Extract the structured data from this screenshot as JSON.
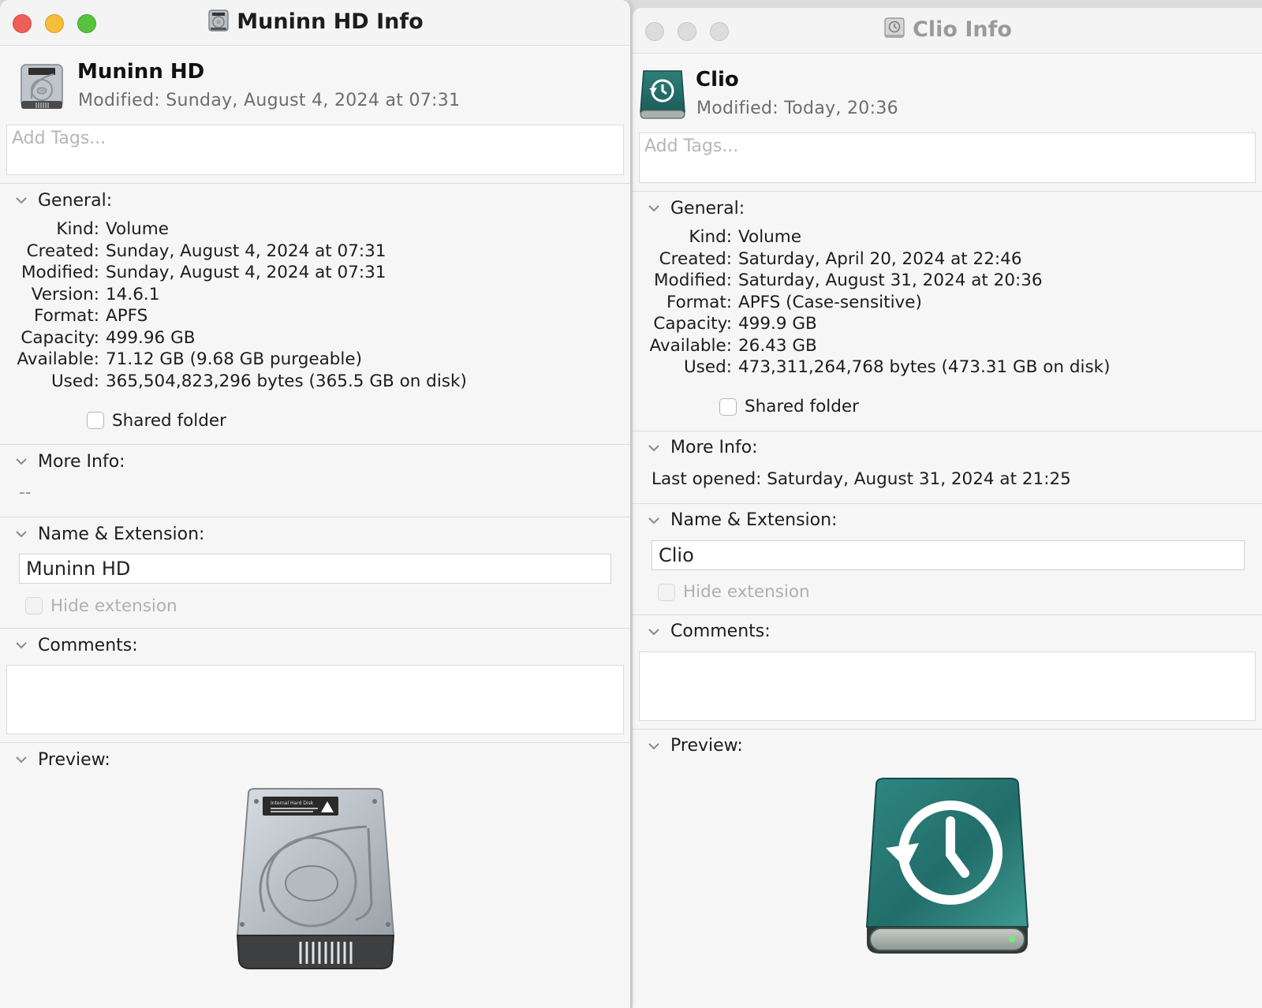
{
  "left": {
    "window_title": "Muninn HD Info",
    "volume_name": "Muninn HD",
    "modified_label": "Modified:",
    "modified_value": "Sunday, August 4, 2024 at 07:31",
    "tags_placeholder": "Add Tags...",
    "general": {
      "label": "General:",
      "rows": [
        {
          "k": "Kind:",
          "v": "Volume"
        },
        {
          "k": "Created:",
          "v": "Sunday, August 4, 2024 at 07:31"
        },
        {
          "k": "Modified:",
          "v": "Sunday, August 4, 2024 at 07:31"
        },
        {
          "k": "Version:",
          "v": "14.6.1"
        },
        {
          "k": "Format:",
          "v": "APFS"
        },
        {
          "k": "Capacity:",
          "v": "499.96 GB"
        },
        {
          "k": "Available:",
          "v": "71.12 GB (9.68 GB purgeable)"
        },
        {
          "k": "Used:",
          "v": "365,504,823,296 bytes (365.5 GB on disk)"
        }
      ],
      "shared_folder": "Shared folder"
    },
    "more_info": {
      "label": "More Info:",
      "text": "--"
    },
    "name_ext": {
      "label": "Name & Extension:",
      "value": "Muninn HD",
      "hide_extension": "Hide extension"
    },
    "comments": {
      "label": "Comments:"
    },
    "preview": {
      "label": "Preview:",
      "disk_label": "Internal Hard Disk"
    }
  },
  "right": {
    "window_title": "Clio Info",
    "volume_name": "Clio",
    "modified_label": "Modified:",
    "modified_value": "Today, 20:36",
    "tags_placeholder": "Add Tags...",
    "general": {
      "label": "General:",
      "rows": [
        {
          "k": "Kind:",
          "v": "Volume"
        },
        {
          "k": "Created:",
          "v": "Saturday, April 20, 2024 at 22:46"
        },
        {
          "k": "Modified:",
          "v": "Saturday, August 31, 2024 at 20:36"
        },
        {
          "k": "Format:",
          "v": "APFS (Case-sensitive)"
        },
        {
          "k": "Capacity:",
          "v": "499.9 GB"
        },
        {
          "k": "Available:",
          "v": "26.43 GB"
        },
        {
          "k": "Used:",
          "v": "473,311,264,768 bytes (473.31 GB on disk)"
        }
      ],
      "shared_folder": "Shared folder"
    },
    "more_info": {
      "label": "More Info:",
      "text": "Last opened: Saturday, August 31, 2024 at 21:25"
    },
    "name_ext": {
      "label": "Name & Extension:",
      "value": "Clio",
      "hide_extension": "Hide extension"
    },
    "comments": {
      "label": "Comments:"
    },
    "preview": {
      "label": "Preview:"
    }
  },
  "colors": {
    "close": "#ee5f57",
    "minimize": "#f5bd3c",
    "zoom": "#58c23f",
    "time_machine_teal": "#2f7f7a",
    "window_bg": "#f6f6f6"
  },
  "icons": {
    "left_volume": "internal-hard-disk-icon",
    "right_volume": "time-machine-disk-icon",
    "disclosure": "chevron-down-icon"
  }
}
